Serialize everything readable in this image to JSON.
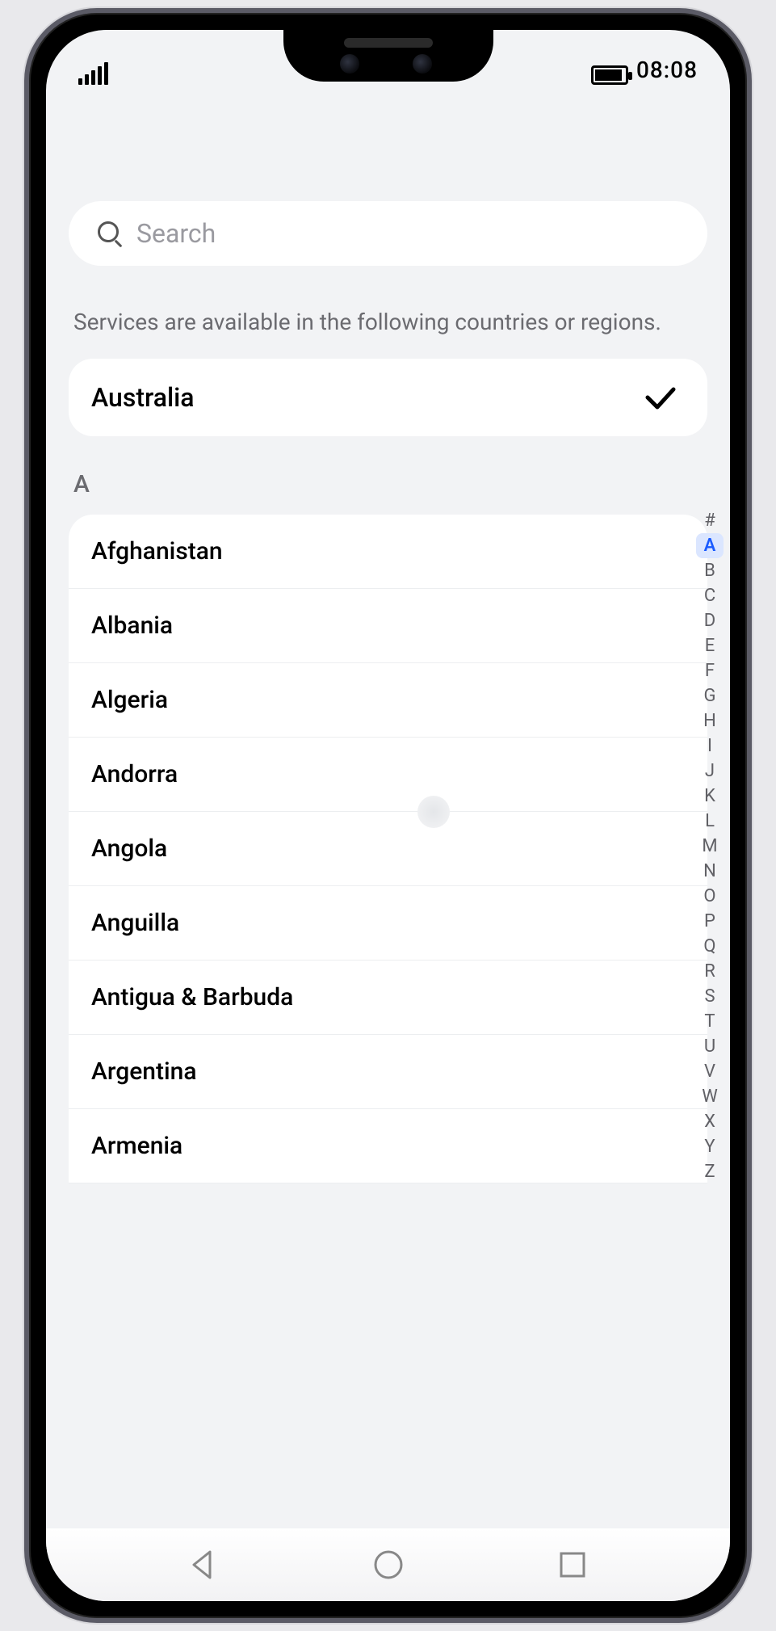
{
  "status": {
    "time": "08:08"
  },
  "search": {
    "placeholder": "Search"
  },
  "description": "Services are available in the following countries or regions.",
  "selected": {
    "name": "Australia"
  },
  "sections": [
    {
      "letter": "A",
      "items": [
        "Afghanistan",
        "Albania",
        "Algeria",
        "Andorra",
        "Angola",
        "Anguilla",
        "Antigua & Barbuda",
        "Argentina",
        "Armenia"
      ]
    }
  ],
  "index": {
    "letters": [
      "#",
      "A",
      "B",
      "C",
      "D",
      "E",
      "F",
      "G",
      "H",
      "I",
      "J",
      "K",
      "L",
      "M",
      "N",
      "O",
      "P",
      "Q",
      "R",
      "S",
      "T",
      "U",
      "V",
      "W",
      "X",
      "Y",
      "Z"
    ],
    "active": "A"
  }
}
